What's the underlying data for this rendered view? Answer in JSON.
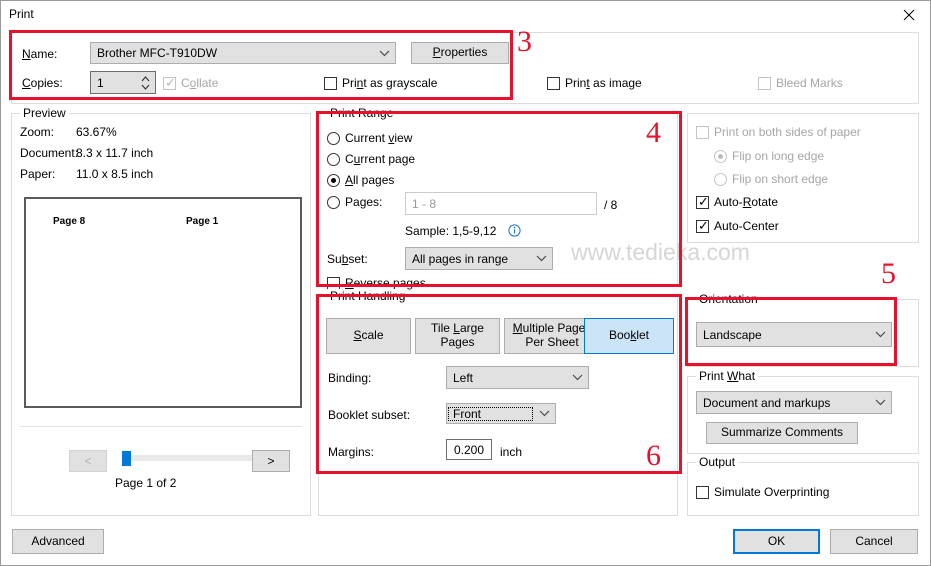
{
  "window": {
    "title": "Print",
    "close_icon": "close-icon"
  },
  "printer": {
    "name_label": "Name:",
    "name_value": "Brother MFC-T910DW",
    "properties_button": "Properties",
    "copies_label": "Copies:",
    "copies_value": "1",
    "collate_label": "Collate",
    "collate_checked": true,
    "collate_enabled": false,
    "grayscale_label": "Print as grayscale",
    "grayscale_checked": false,
    "print_as_image_label": "Print as image",
    "print_as_image_checked": false,
    "bleed_marks_label": "Bleed Marks",
    "bleed_marks_checked": false,
    "bleed_marks_enabled": false
  },
  "preview": {
    "title": "Preview",
    "zoom_label": "Zoom:",
    "zoom_value": "63.67%",
    "document_label": "Document:",
    "document_value": "8.3 x 11.7 inch",
    "paper_label": "Paper:",
    "paper_value": "11.0 x 8.5 inch",
    "sheet_left_label": "Page 8",
    "sheet_right_label": "Page 1",
    "prev_button": "<",
    "next_button": ">",
    "page_status": "Page 1 of 2"
  },
  "print_range": {
    "title": "Print Range",
    "options": [
      {
        "label": "Current view",
        "underline": "v",
        "selected": false
      },
      {
        "label": "Current page",
        "underline": "u",
        "selected": false
      },
      {
        "label": "All pages",
        "underline": "A",
        "selected": true
      },
      {
        "label": "Pages:",
        "underline": "g",
        "selected": false
      }
    ],
    "pages_placeholder": "1 - 8",
    "pages_total": "/ 8",
    "sample_text": "Sample: 1,5-9,12",
    "info_icon": "info-icon",
    "subset_label": "Subset:",
    "subset_value": "All pages in range",
    "reverse_label": "Reverse pages",
    "reverse_checked": false
  },
  "duplex": {
    "both_sides_label": "Print on both sides of paper",
    "both_sides_checked": false,
    "both_sides_enabled": false,
    "flip_long_label": "Flip on long edge",
    "flip_long_selected": true,
    "flip_short_label": "Flip on short edge",
    "flip_short_selected": false,
    "auto_rotate_label": "Auto-Rotate",
    "auto_rotate_checked": true,
    "auto_center_label": "Auto-Center",
    "auto_center_checked": true
  },
  "print_handling": {
    "title": "Print Handling",
    "buttons": [
      {
        "label": "Scale",
        "selected": false
      },
      {
        "label": "Tile Large\nPages",
        "line1": "Tile Large",
        "line2": "Pages",
        "selected": false
      },
      {
        "label": "Multiple Pages\nPer Sheet",
        "line1": "Multiple Pages",
        "line2": "Per Sheet",
        "selected": false
      },
      {
        "label": "Booklet",
        "selected": true
      }
    ],
    "binding_label": "Binding:",
    "binding_value": "Left",
    "subset_label": "Booklet subset:",
    "subset_value": "Front",
    "margins_label": "Margins:",
    "margins_value": "0.200",
    "margins_unit": "inch"
  },
  "orientation": {
    "title": "Orientation",
    "value": "Landscape"
  },
  "print_what": {
    "title": "Print What",
    "value": "Document and markups",
    "summarize_button": "Summarize Comments"
  },
  "output": {
    "title": "Output",
    "overprint_label": "Simulate Overprinting",
    "overprint_checked": false
  },
  "footer": {
    "advanced_button": "Advanced",
    "ok_button": "OK",
    "cancel_button": "Cancel"
  },
  "watermark": "www.tedieka.com",
  "annotations": {
    "color": "#e8112d",
    "numbers": [
      "3",
      "4",
      "5",
      "6"
    ]
  }
}
